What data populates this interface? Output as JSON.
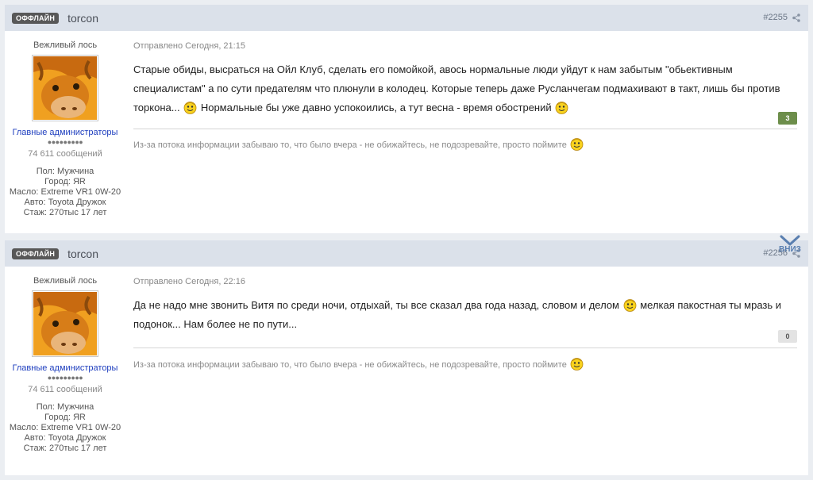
{
  "posts": [
    {
      "status": "ОФФЛАЙН",
      "author": "torcon",
      "number": "#2255",
      "title": "Вежливый лось",
      "group": "Главные администраторы",
      "pips": "●●●●●●●●●",
      "post_count": "74 611 сообщений",
      "info": [
        "Пол: Мужчина",
        "Город: ЯR",
        "Масло: Extreme VR1 0W-20",
        "Авто: Toyota Дружок",
        "Стаж: 270тыс 17 лет"
      ],
      "date": "Отправлено Сегодня, 21:15",
      "text_parts": [
        "Старые обиды, высраться на Ойл Клуб, сделать его помойкой, авось нормальные люди уйдут к нам забытым \"обьективным специалистам\" а по сути предателям что плюнули в колодец. Которые теперь даже Русланчегам подмахивают в такт, лишь бы против торкона...",
        " Нормальные бы уже давно успокоились, а тут весна - время обострений"
      ],
      "reputation": "3",
      "signature": "Из-за потока информации забываю то, что было вчера - не обижайтесь, не подозревайте, просто поймите"
    },
    {
      "status": "ОФФЛАЙН",
      "author": "torcon",
      "number": "#2256",
      "title": "Вежливый лось",
      "group": "Главные администраторы",
      "pips": "●●●●●●●●●",
      "post_count": "74 611 сообщений",
      "info": [
        "Пол: Мужчина",
        "Город: ЯR",
        "Масло: Extreme VR1 0W-20",
        "Авто: Toyota Дружок",
        "Стаж: 270тыс 17 лет"
      ],
      "date": "Отправлено Сегодня, 22:16",
      "text_parts": [
        "Да не надо мне звонить Витя по среди ночи, отдыхай, ты все сказал два года назад, словом и делом",
        " мелкая пакостная ты мразь и подонок... Нам более не по пути..."
      ],
      "reputation": "0",
      "signature": "Из-за потока информации забываю то, что было вчера - не обижайтесь, не подозревайте, просто поймите"
    }
  ],
  "scroll_down": {
    "label": "ВНИЗ"
  },
  "icons": {
    "share": "share-icon",
    "smile": "smile-icon",
    "down": "chevron-down-icon"
  },
  "colors": {
    "header_bg": "#dbe1ea",
    "badge_bg": "#585858",
    "group_link": "#1f3fbf",
    "rep_positive": "#6d8e4b",
    "rep_neutral": "#e3e3e3"
  }
}
